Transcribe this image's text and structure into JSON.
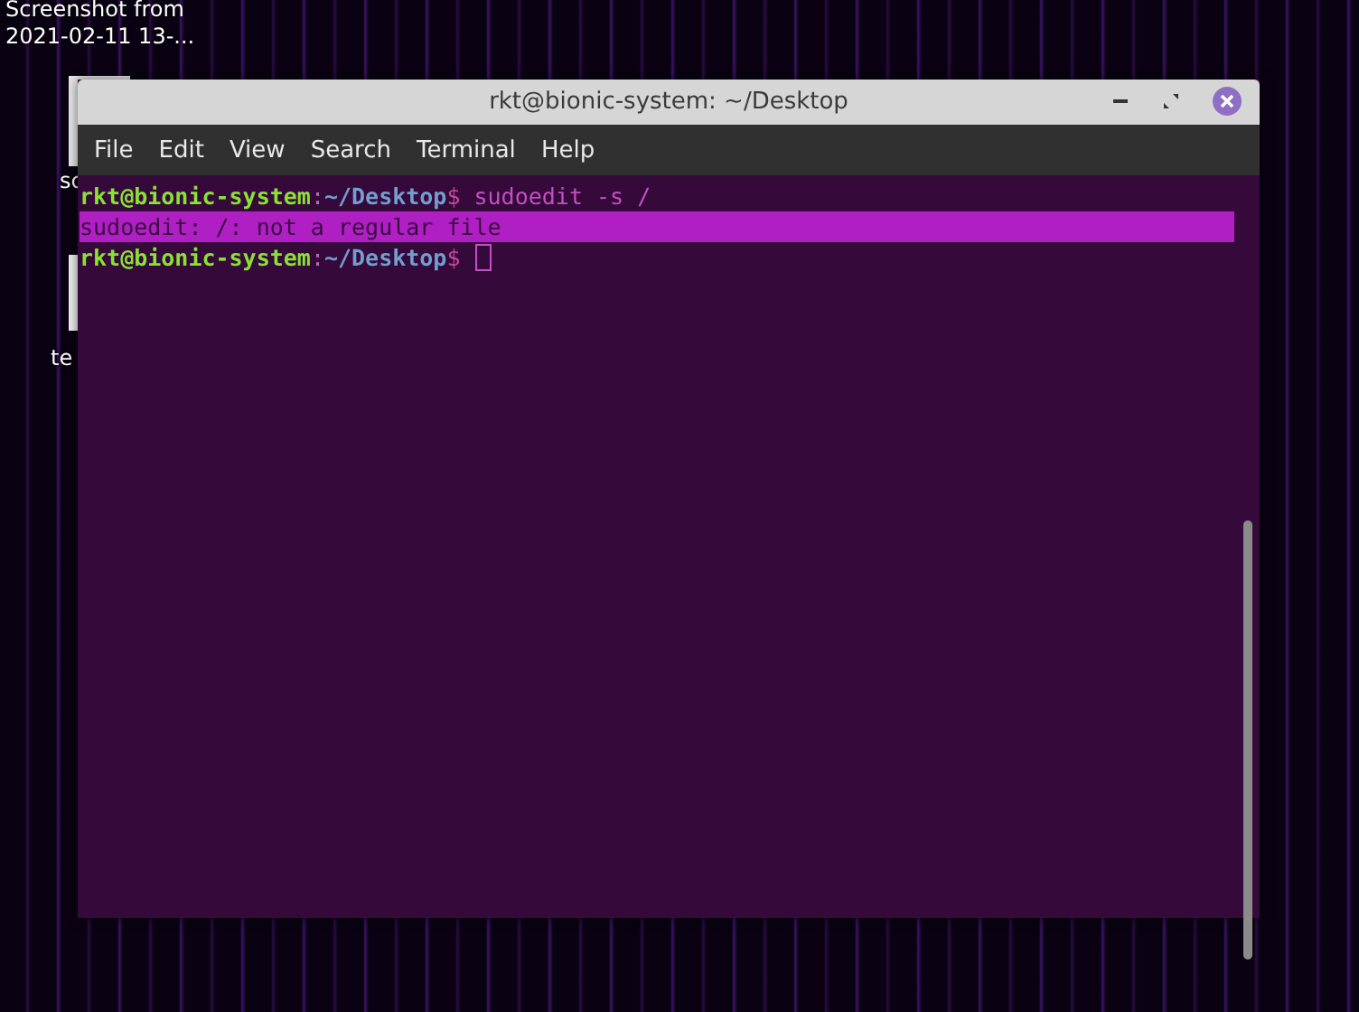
{
  "desktop": {
    "icons": [
      {
        "label_lines": [
          "Screenshot from",
          "2021-02-11 13-..."
        ]
      },
      {
        "label_lines": [
          "sc"
        ]
      },
      {
        "label_lines": [
          "te"
        ]
      }
    ]
  },
  "window": {
    "title": "rkt@bionic-system: ~/Desktop"
  },
  "menu": [
    "File",
    "Edit",
    "View",
    "Search",
    "Terminal",
    "Help"
  ],
  "terminal": {
    "lines": [
      {
        "kind": "prompt",
        "user_host": "rkt@bionic-system",
        "separator": ":",
        "path": "~/Desktop",
        "symbol": "$",
        "command": "sudoedit -s /"
      },
      {
        "kind": "output",
        "text": "sudoedit: /: not a regular file",
        "highlighted": true
      },
      {
        "kind": "prompt",
        "user_host": "rkt@bionic-system",
        "separator": ":",
        "path": "~/Desktop",
        "symbol": "$",
        "cursor": true
      }
    ]
  }
}
